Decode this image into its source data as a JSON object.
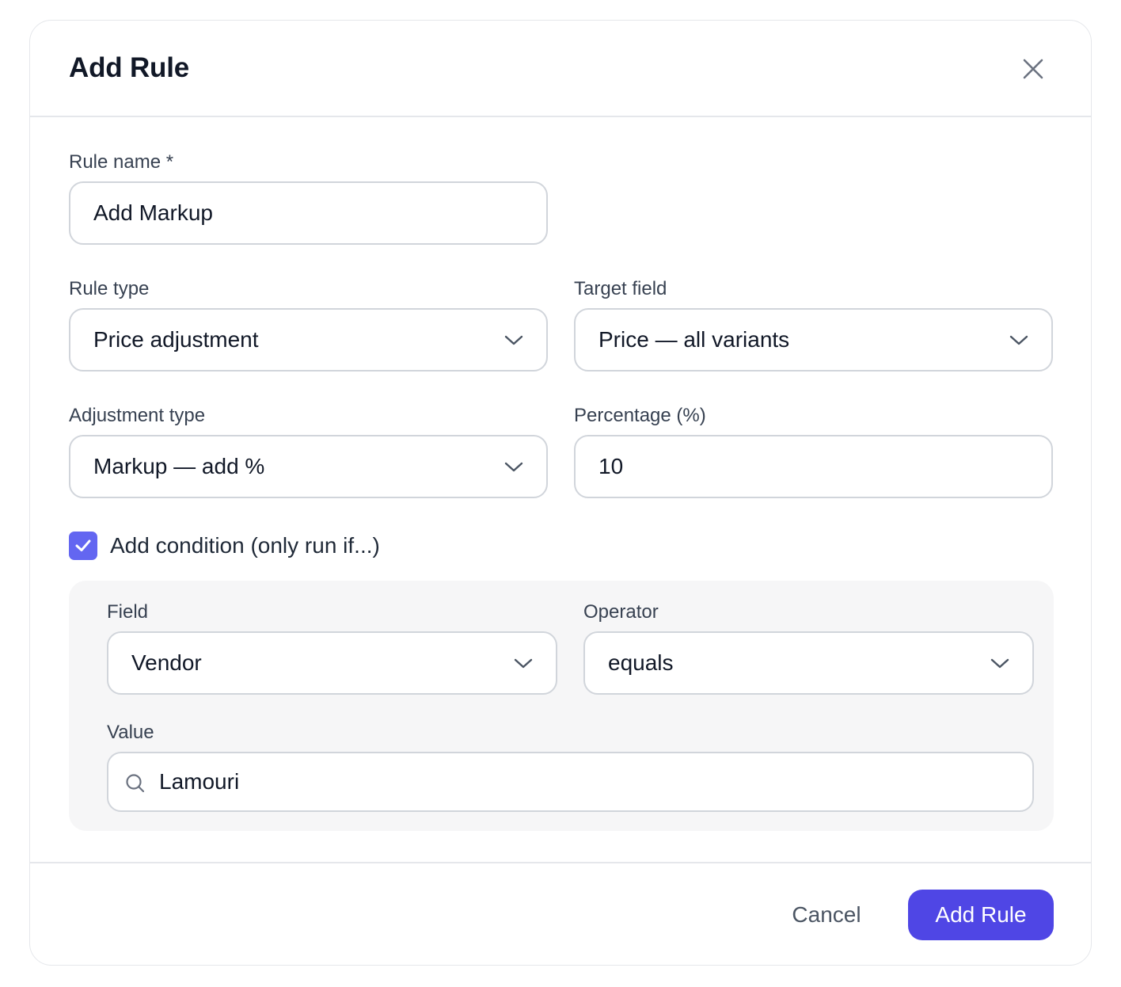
{
  "dialog": {
    "title": "Add Rule",
    "close_icon": "close-icon"
  },
  "rule_name": {
    "label": "Rule name *",
    "value": "Add Markup"
  },
  "rule_type": {
    "label": "Rule type",
    "value": "Price adjustment"
  },
  "target_field": {
    "label": "Target field",
    "value": "Price — all variants"
  },
  "adjustment_type": {
    "label": "Adjustment type",
    "value": "Markup — add %"
  },
  "percentage": {
    "label": "Percentage (%)",
    "value": "10"
  },
  "condition": {
    "checked": true,
    "label": "Add condition (only run if...)",
    "field": {
      "label": "Field",
      "value": "Vendor"
    },
    "operator": {
      "label": "Operator",
      "value": "equals"
    },
    "value": {
      "label": "Value",
      "value": "Lamouri",
      "icon": "search-icon"
    }
  },
  "footer": {
    "cancel_label": "Cancel",
    "submit_label": "Add Rule"
  },
  "colors": {
    "accent": "#4f46e5",
    "checkbox": "#6366f1",
    "panel_bg": "#f6f6f7",
    "border": "#d1d5db"
  }
}
